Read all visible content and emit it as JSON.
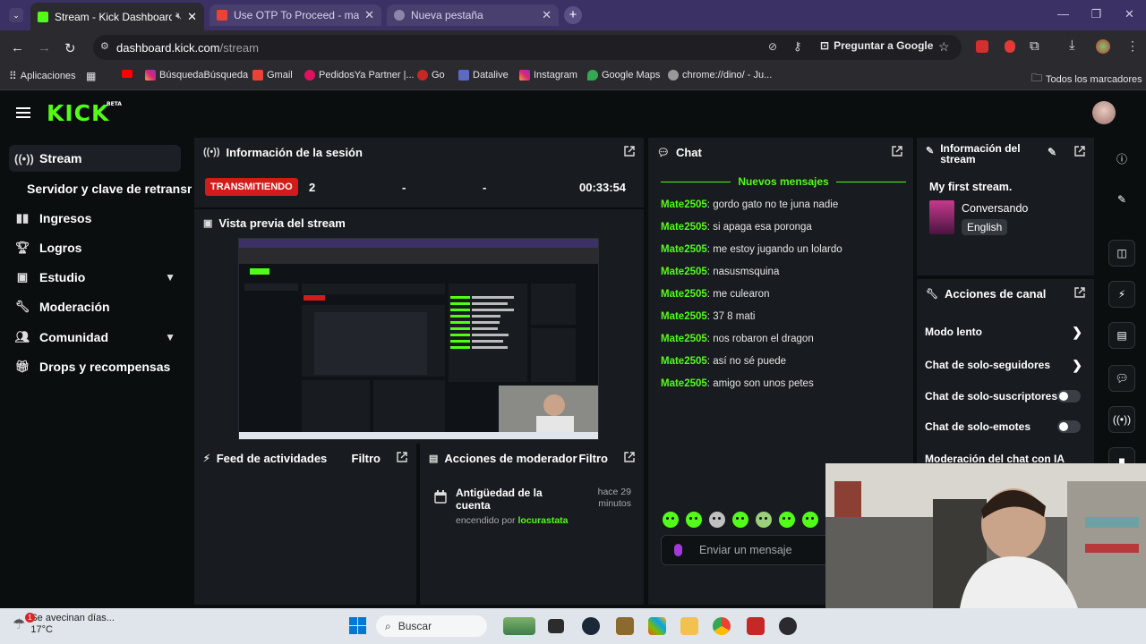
{
  "browser": {
    "tabs": [
      {
        "title": "Stream - Kick Dashboard",
        "active": true
      },
      {
        "title": "Use OTP To Proceed - matiasca",
        "active": false
      },
      {
        "title": "Nueva pestaña",
        "active": false
      }
    ],
    "url_host": "dashboard.kick.com",
    "url_path": "/stream",
    "ask_google": "Preguntar a Google",
    "bookmarks": [
      "Aplicaciones",
      "BúsquedaBúsqueda",
      "Gmail",
      "PedidosYa Partner |...",
      "Go",
      "Datalive",
      "Instagram",
      "Google Maps",
      "chrome://dino/ - Ju...",
      "Todos los marcadores"
    ]
  },
  "kick": {
    "logo": "KICK",
    "logo_tag": "BETA"
  },
  "sidebar": {
    "items": [
      {
        "label": "Stream",
        "icon": "broadcast-icon"
      },
      {
        "label": "Servidor y clave de retransm",
        "icon": ""
      },
      {
        "label": "Ingresos",
        "icon": "bar-chart-icon"
      },
      {
        "label": "Logros",
        "icon": "trophy-icon"
      },
      {
        "label": "Estudio",
        "icon": "studio-icon"
      },
      {
        "label": "Moderación",
        "icon": "wrench-icon"
      },
      {
        "label": "Comunidad",
        "icon": "users-icon"
      },
      {
        "label": "Drops y recompensas",
        "icon": "gift-icon"
      }
    ]
  },
  "session": {
    "title": "Información de la sesión",
    "status": "TRANSMITIENDO",
    "viewers": "2",
    "stat2": "-",
    "stat3": "-",
    "duration": "00:33:54"
  },
  "preview": {
    "title": "Vista previa del stream"
  },
  "feed": {
    "title": "Feed de actividades",
    "filter": "Filtro"
  },
  "mod_actions": {
    "title": "Acciones de moderador",
    "filter": "Filtro",
    "entry_title": "Antigüedad de la cuenta",
    "entry_time": "hace 29 minutos",
    "entry_by_prefix": "encendido por",
    "entry_by_user": "locurastata"
  },
  "chat": {
    "title": "Chat",
    "new_messages": "Nuevos mensajes",
    "messages": [
      {
        "user": "Mate2505",
        "text": "gordo gato no te juna nadie"
      },
      {
        "user": "Mate2505",
        "text": "si apaga esa poronga"
      },
      {
        "user": "Mate2505",
        "text": "me estoy jugando un lolardo"
      },
      {
        "user": "Mate2505",
        "text": "nasusmsquina"
      },
      {
        "user": "Mate2505",
        "text": "me culearon"
      },
      {
        "user": "Mate2505",
        "text": "37 8 mati"
      },
      {
        "user": "Mate2505",
        "text": "nos robaron el dragon"
      },
      {
        "user": "Mate2505",
        "text": "así no sé puede"
      },
      {
        "user": "Mate2505",
        "text": "amigo son unos petes"
      }
    ],
    "input_placeholder": "Enviar un mensaje"
  },
  "stream_info": {
    "title": "Información del stream",
    "stream_title": "My first stream.",
    "category": "Conversando",
    "language": "English"
  },
  "channel_actions": {
    "title": "Acciones de canal",
    "items": [
      {
        "label": "Modo lento",
        "control": "arrow"
      },
      {
        "label": "Chat de solo-seguidores",
        "control": "arrow"
      },
      {
        "label": "Chat de solo-suscriptores",
        "control": "toggle",
        "on": false
      },
      {
        "label": "Chat de solo-emotes",
        "control": "toggle",
        "on": false
      },
      {
        "label": "Moderación del chat con IA",
        "control": "external"
      }
    ]
  },
  "taskbar": {
    "weather_text": "Se avecinan días...",
    "temperature": "17°C",
    "notification_count": "1",
    "search_placeholder": "Buscar"
  },
  "colors": {
    "accent": "#53fc18",
    "live": "#d31b1b",
    "tab_bar": "#3b3164",
    "panel": "#181b1f",
    "background": "#0b0e0f"
  }
}
